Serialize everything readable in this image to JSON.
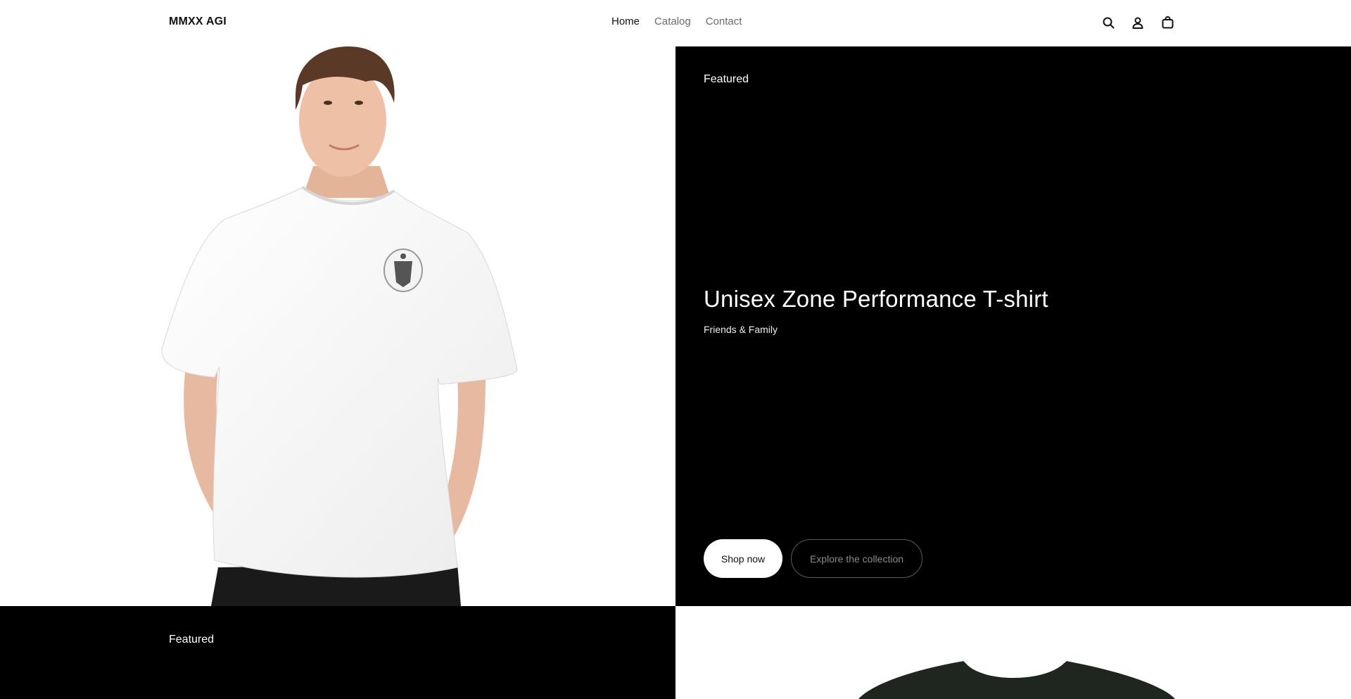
{
  "header": {
    "logo": "MMXX AGI",
    "nav": [
      {
        "label": "Home",
        "active": true
      },
      {
        "label": "Catalog",
        "active": false
      },
      {
        "label": "Contact",
        "active": false
      }
    ],
    "icons": [
      "search-icon",
      "account-icon",
      "cart-icon"
    ]
  },
  "hero": {
    "image_alt": "Man wearing white t-shirt with crest emblem",
    "eyebrow": "Featured",
    "title": "Unisex Zone Performance T-shirt",
    "subtitle": "Friends & Family",
    "primary_button": "Shop now",
    "secondary_button": "Explore the collection"
  },
  "second_row": {
    "eyebrow": "Featured",
    "image_alt": "Dark green t-shirt"
  },
  "colors": {
    "panel_bg": "#000000",
    "page_bg": "#ffffff",
    "shirt_dark": "#1f261f"
  }
}
